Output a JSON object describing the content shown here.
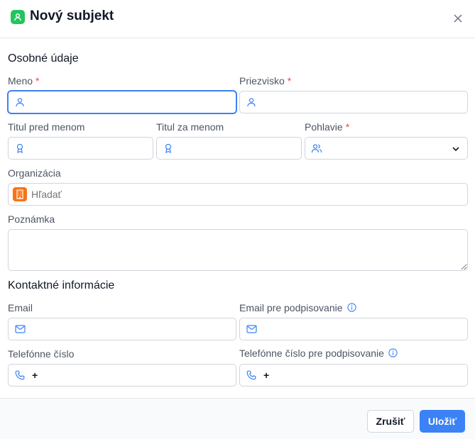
{
  "dialog": {
    "title": "Nový subjekt",
    "title_icon": "user-icon",
    "accent_color": "#22c55e"
  },
  "personal": {
    "heading": "Osobné údaje",
    "first_name": {
      "label": "Meno",
      "required_mark": "*",
      "value": ""
    },
    "last_name": {
      "label": "Priezvisko",
      "required_mark": "*",
      "value": ""
    },
    "title_before": {
      "label": "Titul pred menom",
      "value": ""
    },
    "title_after": {
      "label": "Titul za menom",
      "value": ""
    },
    "gender": {
      "label": "Pohlavie",
      "required_mark": "*",
      "value": ""
    },
    "organization": {
      "label": "Organizácia",
      "placeholder": "Hľadať"
    },
    "note": {
      "label": "Poznámka",
      "value": ""
    }
  },
  "contact": {
    "heading": "Kontaktné informácie",
    "email": {
      "label": "Email",
      "value": ""
    },
    "signing_email": {
      "label": "Email pre podpisovanie",
      "value": ""
    },
    "phone": {
      "label": "Telefónne číslo",
      "prefix": "+"
    },
    "signing_phone": {
      "label": "Telefónne číslo pre podpisovanie",
      "prefix": "+"
    }
  },
  "footer": {
    "cancel_label": "Zrušiť",
    "save_label": "Uložiť",
    "primary_color": "#3b82f6"
  },
  "colors": {
    "required": "#ef4444",
    "icon_blue": "#3b82f6",
    "org_badge": "#f97316"
  }
}
